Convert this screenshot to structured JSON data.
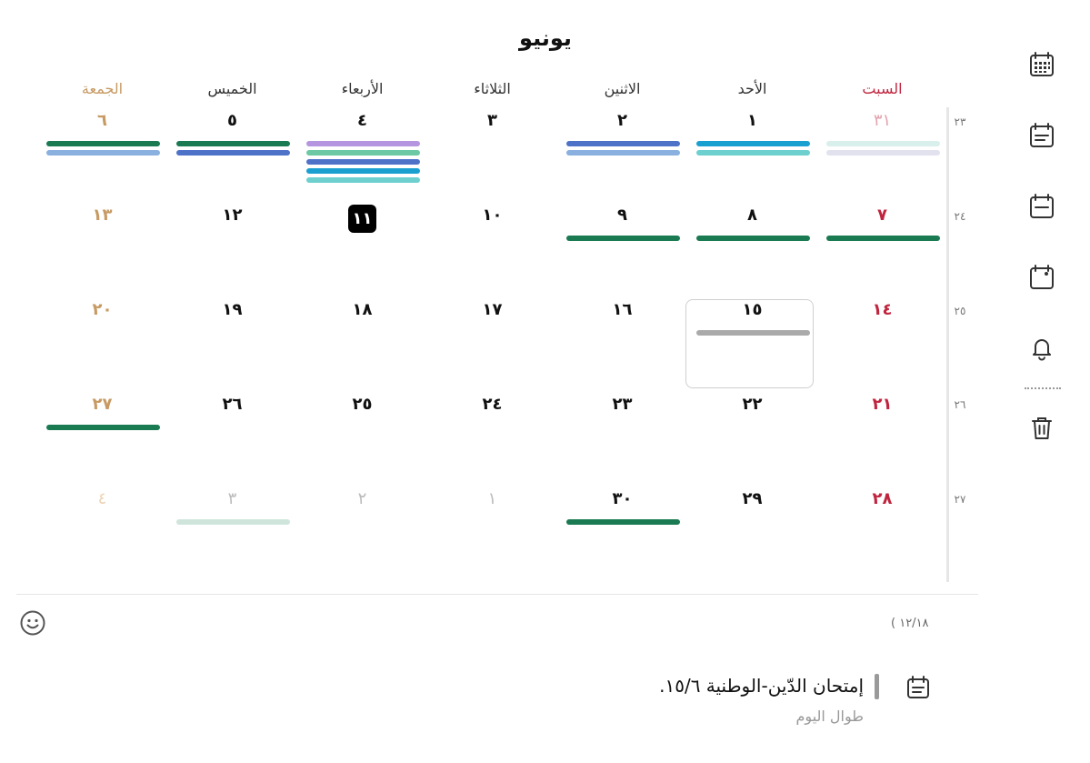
{
  "month": "يونيو",
  "day_headers": [
    "السبت",
    "الأحد",
    "الاثنين",
    "الثلاثاء",
    "الأربعاء",
    "الخميس",
    "الجمعة"
  ],
  "week_numbers": [
    "٢٣",
    "٢٤",
    "٢٥",
    "٢٦",
    "٢٧"
  ],
  "weeks": [
    [
      "٣١",
      "١",
      "٢",
      "٣",
      "٤",
      "٥",
      "٦"
    ],
    [
      "٧",
      "٨",
      "٩",
      "١٠",
      "١١",
      "١٢",
      "١٣"
    ],
    [
      "١٤",
      "١٥",
      "١٦",
      "١٧",
      "١٨",
      "١٩",
      "٢٠"
    ],
    [
      "٢١",
      "٢٢",
      "٢٣",
      "٢٤",
      "٢٥",
      "٢٦",
      "٢٧"
    ],
    [
      "٢٨",
      "٢٩",
      "٣٠",
      "١",
      "٢",
      "٣",
      "٤"
    ]
  ],
  "colors": {
    "saturday": "#c0253f",
    "friday": "#c79a63",
    "green": "#1a7a52",
    "blue": "#4f72c9",
    "light_blue": "#8ab0e0",
    "cyan": "#1aa0d0",
    "teal": "#6dd0cf",
    "purple": "#b595e0",
    "mint": "#6cc9a4",
    "gray": "#aaaaaa"
  },
  "counter": "( ١٢/١٨",
  "event": {
    "title": "إمتحان الدّين-الوطنية ١٥/٦.",
    "subtitle": "طوال اليوم",
    "icon": "calendar-note-icon"
  },
  "sidebar_icons": [
    "calendar-grid-icon",
    "calendar-note-icon",
    "calendar-day-icon",
    "calendar-dot-icon",
    "bell-icon",
    "trash-icon"
  ]
}
